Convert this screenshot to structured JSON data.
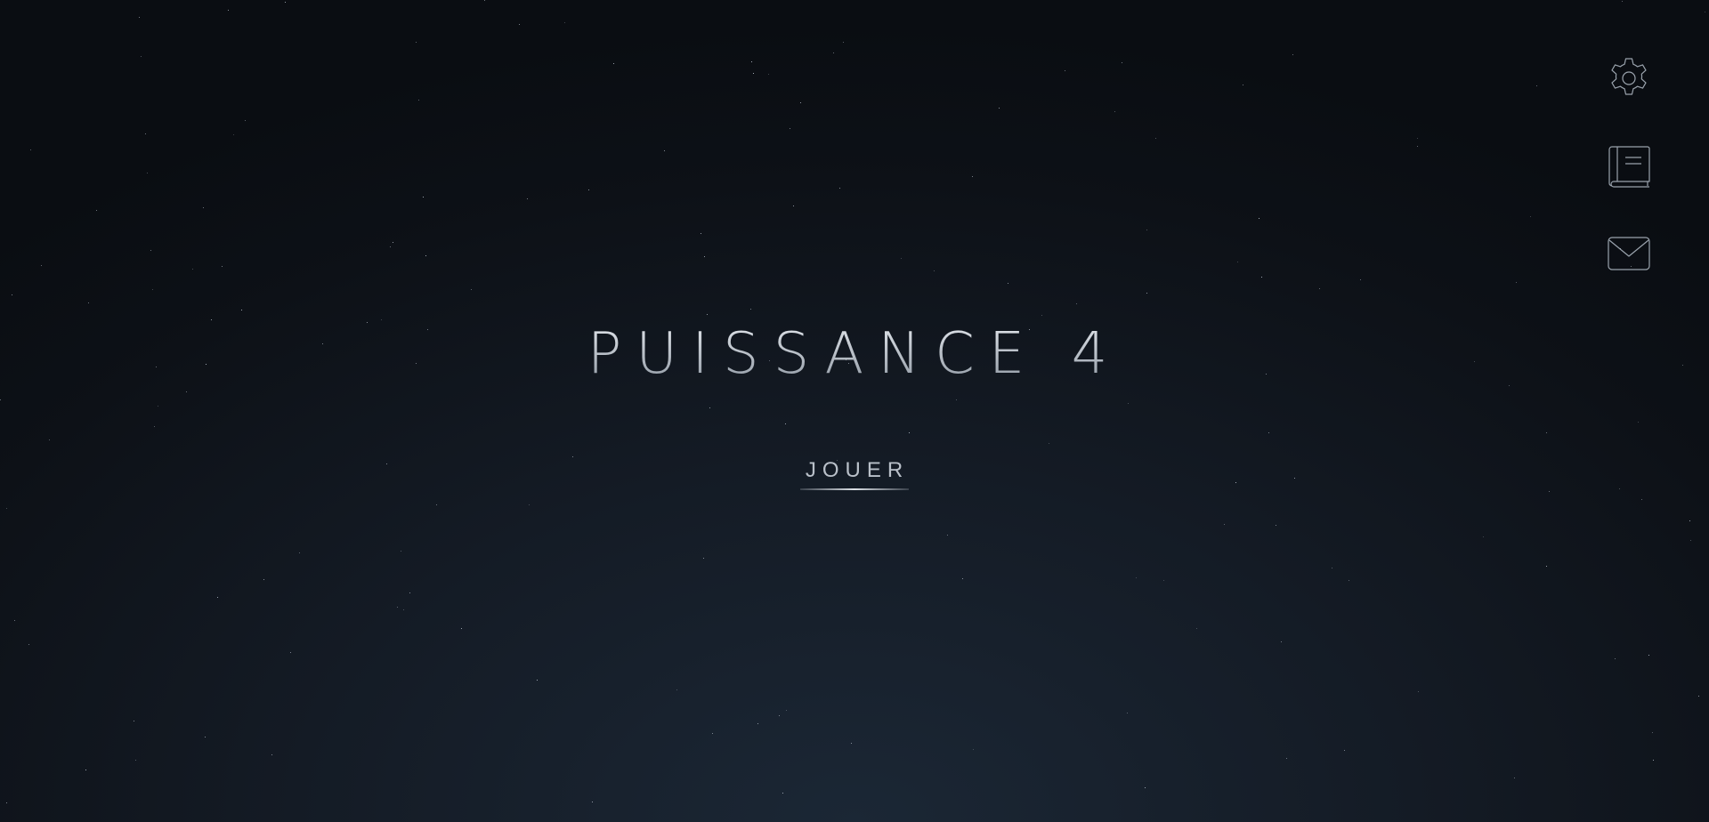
{
  "title": "PUISSANCE 4",
  "play_label": "JOUER",
  "icons": [
    {
      "name": "settings",
      "icon": "gear-icon"
    },
    {
      "name": "rules",
      "icon": "book-icon"
    },
    {
      "name": "contact",
      "icon": "envelope-icon"
    }
  ],
  "colors": {
    "background_center": "#1b2735",
    "background_edge": "#0a0d12",
    "text": "#b9c0c9",
    "icon_stroke": "#9aa3ad"
  }
}
